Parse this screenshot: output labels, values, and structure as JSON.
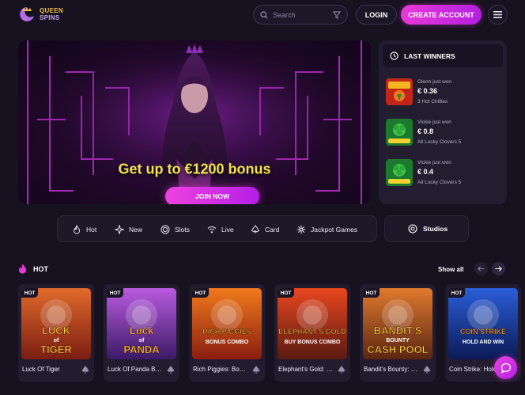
{
  "brand": {
    "line1": "QUEEN",
    "line2": "SPINS"
  },
  "header": {
    "search_placeholder": "Search",
    "login_label": "LOGIN",
    "create_label": "CREATE ACCOUNT"
  },
  "hero": {
    "title": "Get up to €1200 bonus",
    "cta": "JOIN NOW"
  },
  "winners": {
    "title": "LAST WINNERS",
    "items": [
      {
        "who": "Glenn just won",
        "amount": "€ 0.36",
        "game": "3 Hot Chillies"
      },
      {
        "who": "Vickie just won",
        "amount": "€ 0.8",
        "game": "All Lucky Clovers 5"
      },
      {
        "who": "Vickie just won",
        "amount": "€ 0.4",
        "game": "All Lucky Clovers 5"
      }
    ]
  },
  "categories": {
    "items": [
      {
        "label": "Hot",
        "icon": "flame-icon"
      },
      {
        "label": "New",
        "icon": "sparkle-icon"
      },
      {
        "label": "Slots",
        "icon": "spiral-icon"
      },
      {
        "label": "Live",
        "icon": "wifi-icon"
      },
      {
        "label": "Card",
        "icon": "spade-icon"
      },
      {
        "label": "Jackpot Games",
        "icon": "star-burst-icon"
      }
    ],
    "studios_label": "Studios"
  },
  "hot": {
    "title": "HOT",
    "show_all": "Show all",
    "badge": "HOT",
    "games": [
      {
        "name": "Luck Of Tiger",
        "art_line1": "LUCK",
        "art_line2": "of",
        "art_line3": "TIGER",
        "bg1": "#e06a2a",
        "bg2": "#7a1d12"
      },
      {
        "name": "Luck Of Panda Bonus Combo",
        "art_line1": "Luck",
        "art_line2": "of",
        "art_line3": "PANDA",
        "bg1": "#b95be0",
        "bg2": "#3b1a66"
      },
      {
        "name": "Rich Piggies: Bonus Combo",
        "art_line1": "RICH PIGGIES",
        "art_line2": "BONUS COMBO",
        "art_line3": "",
        "bg1": "#f07a1c",
        "bg2": "#8a1e10"
      },
      {
        "name": "Elephant's Gold: Buy Bonus Combo",
        "art_line1": "ELEPHANT'S GOLD",
        "art_line2": "BUY BONUS COMBO",
        "art_line3": "",
        "bg1": "#e8471e",
        "bg2": "#5a1a10"
      },
      {
        "name": "Bandit's Bounty: Cash Pool",
        "art_line1": "BANDIT'S",
        "art_line2": "BOUNTY",
        "art_line3": "CASH POOL",
        "bg1": "#e07a2e",
        "bg2": "#5a2612"
      },
      {
        "name": "Coin Strike: Hold and Win",
        "art_line1": "COIN STRIKE",
        "art_line2": "HOLD AND WIN",
        "art_line3": "",
        "bg1": "#2a5ed8",
        "bg2": "#0c1a55"
      }
    ]
  },
  "colors": {
    "accent": "#e83ad8",
    "background": "#16121f",
    "panel": "#231d30",
    "hero_title": "#f1e44a"
  }
}
